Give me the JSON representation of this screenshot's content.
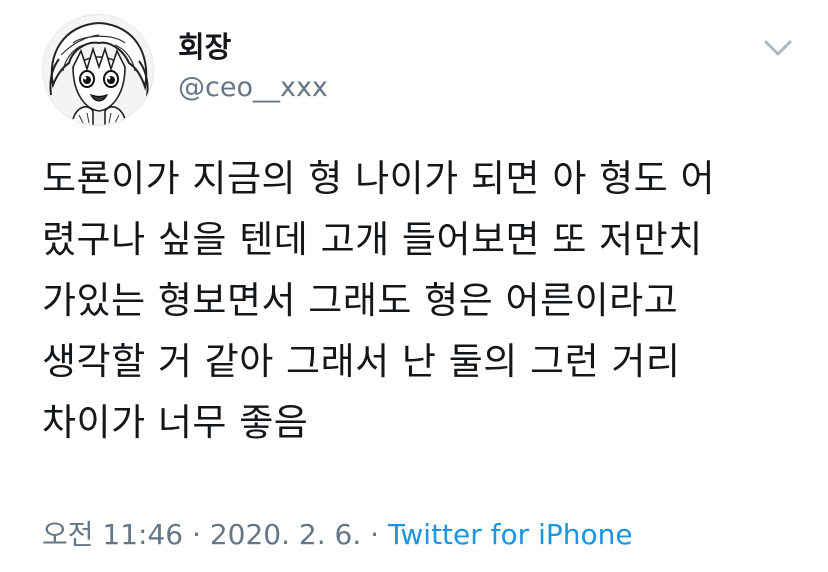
{
  "user": {
    "display_name": "회장",
    "handle": "@ceo__xxx",
    "avatar_icon": "manga-character-avatar"
  },
  "menu": {
    "icon": "chevron-down-icon"
  },
  "tweet": {
    "lines": [
      "도룐이가 지금의 형 나이가 되면 아 형도 어",
      "렸구나 싶을 텐데 고개 들어보면 또 저만치",
      "가있는 형보면서 그래도 형은 어른이라고",
      "생각할 거 같아 그래서 난 둘의 그런 거리",
      "차이가 너무 좋음"
    ]
  },
  "meta": {
    "time": "오전 11:46",
    "separator": " · ",
    "date": "2020. 2. 6.",
    "separator2": " · ",
    "source": "Twitter for iPhone"
  },
  "colors": {
    "text": "#14171a",
    "secondary": "#657786",
    "link": "#1b95e0"
  }
}
